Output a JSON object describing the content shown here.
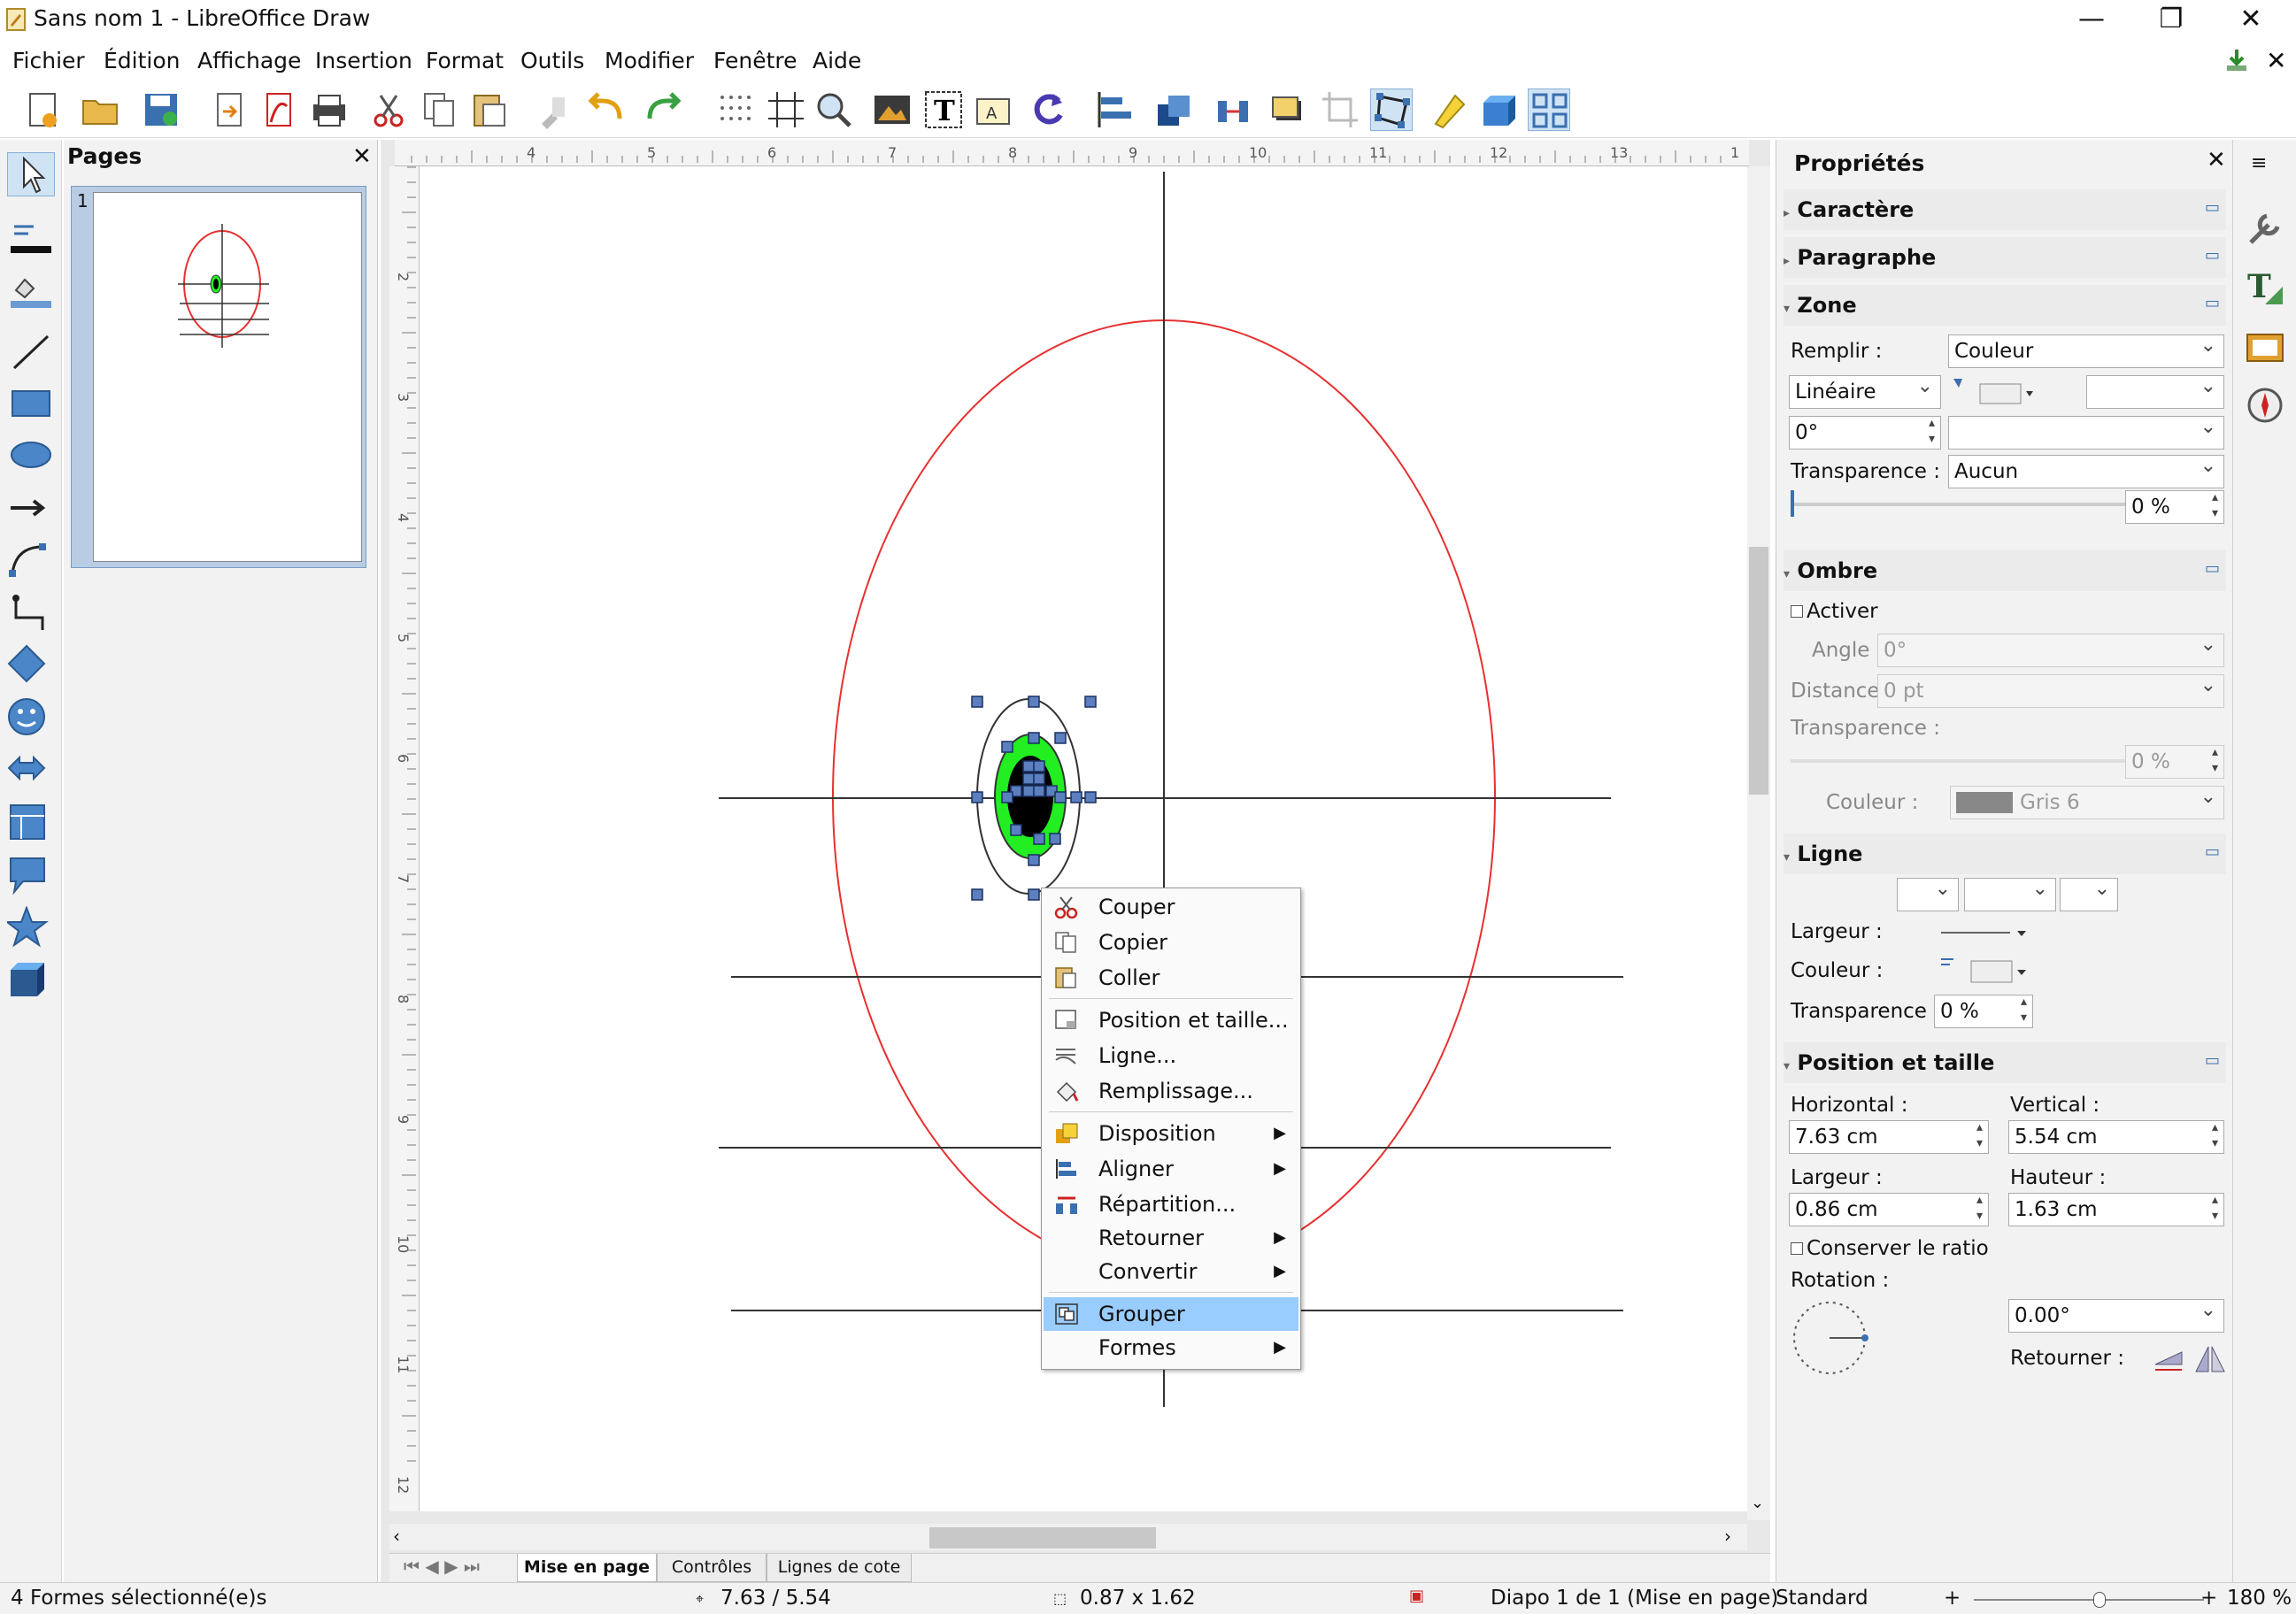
{
  "window": {
    "title": "Sans nom 1 - LibreOffice Draw",
    "minimize": "—",
    "restore": "❐",
    "close": "✕"
  },
  "menubar": [
    "Fichier",
    "Édition",
    "Affichage",
    "Insertion",
    "Format",
    "Outils",
    "Modifier",
    "Fenêtre",
    "Aide"
  ],
  "pages_panel": {
    "title": "Pages",
    "page_number": "1"
  },
  "ruler": {
    "h_ticks": [
      "4",
      "5",
      "6",
      "7",
      "8",
      "9",
      "10",
      "11",
      "12",
      "13",
      "1"
    ],
    "v_ticks": [
      "2",
      "3",
      "4",
      "5",
      "6",
      "7",
      "8",
      "9",
      "10",
      "11",
      "12"
    ]
  },
  "tabs": [
    "Mise en page",
    "Contrôles",
    "Lignes de cote"
  ],
  "context_menu": {
    "items": [
      {
        "label": "Couper",
        "icon": "scissors-icon"
      },
      {
        "label": "Copier",
        "icon": "copy-icon"
      },
      {
        "label": "Coller",
        "icon": "paste-icon"
      },
      {
        "label": "Position et taille...",
        "icon": "position-size-icon"
      },
      {
        "label": "Ligne...",
        "icon": "line-icon"
      },
      {
        "label": "Remplissage...",
        "icon": "fill-icon"
      },
      {
        "label": "Disposition",
        "icon": "arrange-icon",
        "submenu": true
      },
      {
        "label": "Aligner",
        "icon": "align-icon",
        "submenu": true
      },
      {
        "label": "Répartition...",
        "icon": "distribute-icon"
      },
      {
        "label": "Retourner",
        "submenu": true
      },
      {
        "label": "Convertir",
        "submenu": true
      },
      {
        "label": "Grouper",
        "icon": "group-icon",
        "selected": true
      },
      {
        "label": "Formes",
        "submenu": true
      }
    ]
  },
  "sidebar": {
    "title": "Propriétés",
    "sections": {
      "caractere": "Caractère",
      "paragraphe": "Paragraphe",
      "zone": "Zone",
      "ombre": "Ombre",
      "ligne": "Ligne",
      "position": "Position et taille"
    },
    "zone": {
      "remplir_label": "Remplir :",
      "remplir_value": "Couleur",
      "gradient_type": "Linéaire",
      "angle": "0°",
      "transparence_label": "Transparence :",
      "transparence_value": "Aucun",
      "transparence_pct": "0 %"
    },
    "ombre": {
      "activer": "Activer",
      "angle_label": "Angle",
      "angle_value": "0°",
      "distance_label": "Distance",
      "distance_value": "0 pt",
      "transparence_label": "Transparence :",
      "transparence_value": "0 %",
      "couleur_label": "Couleur :",
      "couleur_value": "Gris 6"
    },
    "ligne": {
      "largeur_label": "Largeur :",
      "couleur_label": "Couleur :",
      "transparence_label": "Transparence :",
      "transparence_value": "0 %"
    },
    "position": {
      "horizontal_label": "Horizontal :",
      "horizontal_value": "7.63 cm",
      "vertical_label": "Vertical :",
      "vertical_value": "5.54 cm",
      "largeur_label": "Largeur :",
      "largeur_value": "0.86 cm",
      "hauteur_label": "Hauteur :",
      "hauteur_value": "1.63 cm",
      "ratio_label": "Conserver le ratio",
      "rotation_label": "Rotation :",
      "rotation_value": "0.00°",
      "retourner_label": "Retourner :"
    }
  },
  "statusbar": {
    "selection": "4 Formes sélectionné(e)s",
    "position": "7.63 / 5.54",
    "size": "0.87 x 1.62",
    "slide": "Diapo 1 de 1 (Mise en page)",
    "style": "Standard",
    "zoom": "180 %"
  },
  "colors": {
    "selection_highlight": "#99ccff",
    "ellipse_outer": "#e83030",
    "ellipse_green": "#22ee22",
    "handle": "#5b7fbf"
  }
}
